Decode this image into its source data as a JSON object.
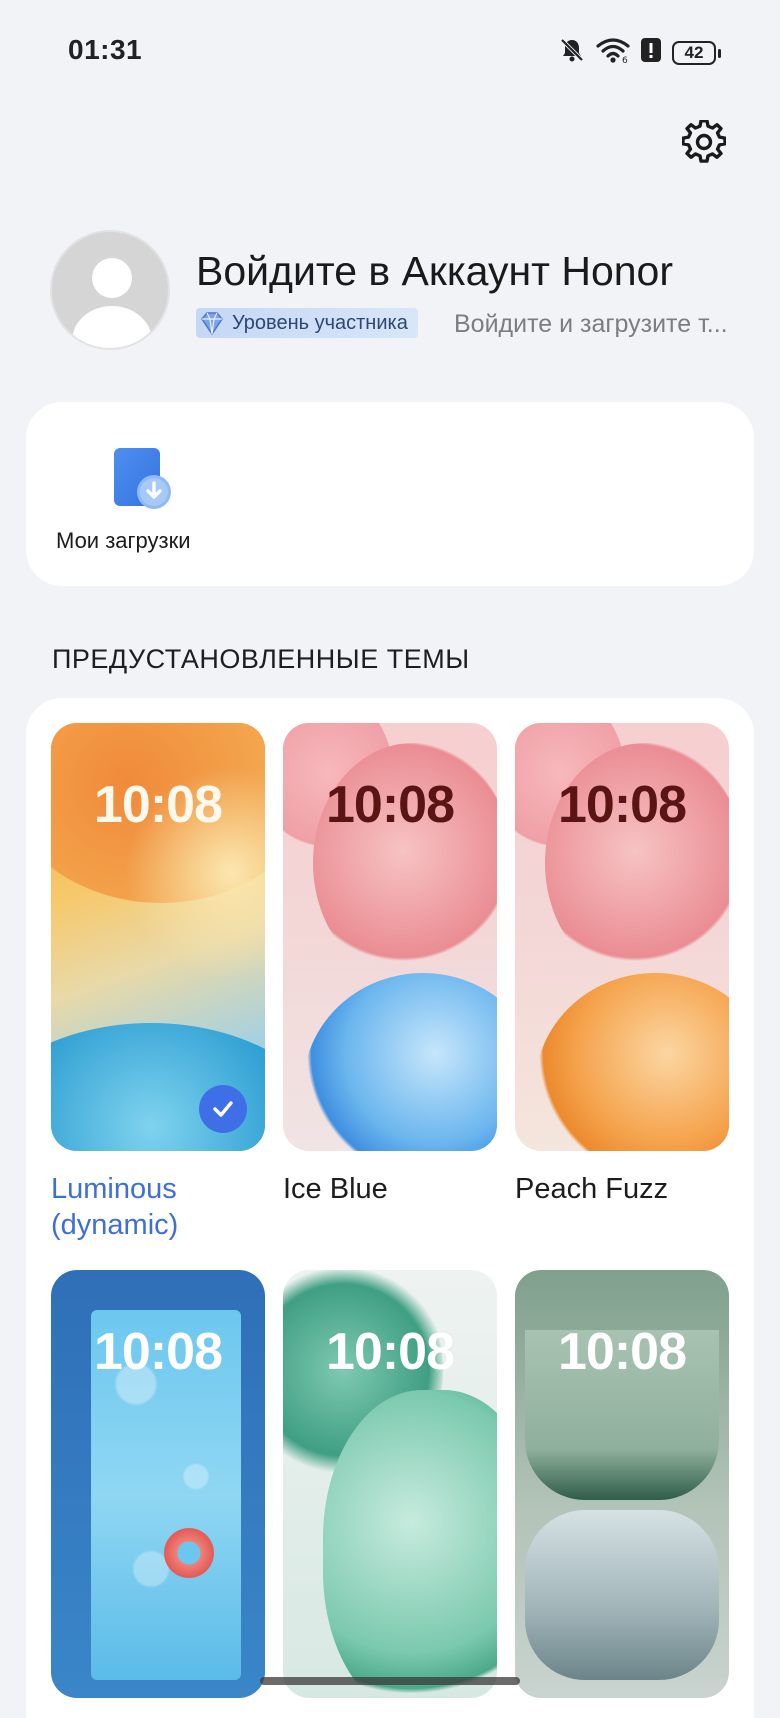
{
  "status_bar": {
    "time": "01:31",
    "battery": "42",
    "icons": [
      "mute-icon",
      "wifi-icon",
      "alert-icon",
      "battery-icon"
    ]
  },
  "header": {
    "settings_icon": "gear-icon"
  },
  "account": {
    "title": "Войдите в Аккаунт Honor",
    "badge": "Уровень участника",
    "hint": "Войдите и загрузите т..."
  },
  "shortcuts": {
    "downloads_label": "Мои загрузки"
  },
  "themes": {
    "section_title": "ПРЕДУСТАНОВЛЕННЫЕ ТЕМЫ",
    "items": [
      {
        "name": "Luminous (dynamic)",
        "time": "10:08",
        "selected": true
      },
      {
        "name": "Ice Blue",
        "time": "10:08",
        "selected": false
      },
      {
        "name": "Peach Fuzz",
        "time": "10:08",
        "selected": false
      },
      {
        "name": "",
        "time": "10:08",
        "selected": false
      },
      {
        "name": "",
        "time": "10:08",
        "selected": false
      },
      {
        "name": "",
        "time": "10:08",
        "selected": false
      }
    ]
  },
  "colors": {
    "accent": "#3f6fd6",
    "background": "#f1f3f6",
    "card": "#ffffff"
  }
}
